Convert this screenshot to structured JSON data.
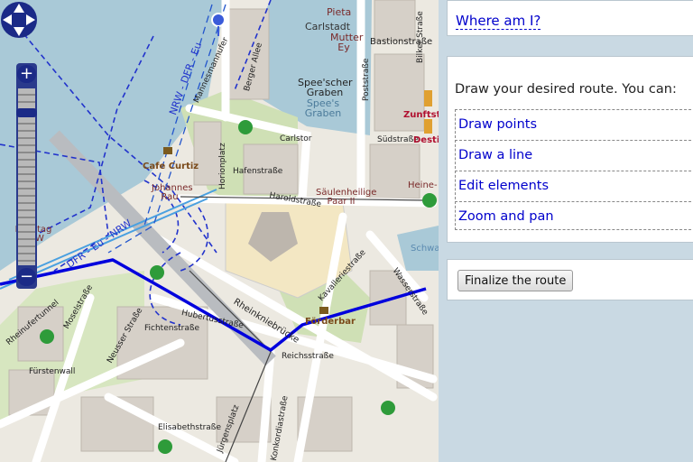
{
  "map": {
    "labels": [
      "Pieta",
      "Carlstadt",
      "Mutter Ey",
      "Bastionstraße",
      "Bilker Straße",
      "Spee'scher Graben",
      "Spee's Graben",
      "Poststraße",
      "Zunftst",
      "Südstraße",
      "Desti",
      "Carlstor",
      "Säulenheilige Paar II",
      "Heine-",
      "Cafe Curtiz",
      "Johannes Rau",
      "Haroldstraße",
      "Hafenstraße",
      "Horionplatz",
      "Landtag NRW",
      "Schwa",
      "Rheinkniebrücke",
      "Kavalleriestraße",
      "Wasserstraße",
      "Förderbar",
      "Reichsstraße",
      "Hubertusstraße",
      "Fürstenwall",
      "Neusser Straße",
      "Moselstraße",
      "Rheinufertunnel",
      "Jürgensplatz",
      "Konkordiastraße",
      "Fichtenstraße",
      "Elisabethstraße",
      "Berger Allee",
      "Mannesmannufer",
      "DFR - Eu - NRW",
      "NRW - DFR - Eu"
    ]
  },
  "panel": {
    "where_am_i": "Where am I?",
    "intro": "Draw your desired route. You can:",
    "tools": [
      "Draw points",
      "Draw a line",
      "Edit elements",
      "Zoom and pan"
    ],
    "finalize": "Finalize the route"
  },
  "zoom": {
    "plus": "+",
    "minus": "−",
    "level": 0.12
  },
  "colors": {
    "route": "#0000dd",
    "water": "#a9c9d7",
    "link": "#0000cc",
    "panel_bg": "#c9d9e3"
  }
}
